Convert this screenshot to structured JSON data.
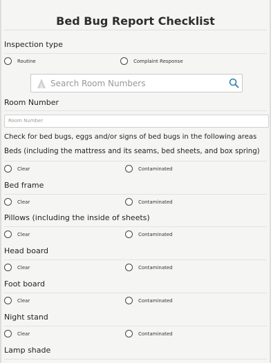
{
  "form": {
    "title": "Bed Bug Report Checklist",
    "inspection_type": {
      "label": "Inspection type",
      "options": [
        "Routine",
        "Complaint Response"
      ]
    },
    "search": {
      "placeholder": "Search Room Numbers"
    },
    "room_number": {
      "label": "Room Number",
      "placeholder": "Room Number"
    },
    "instructions": "Check for bed bugs, eggs and/or signs of bed bugs in the following areas",
    "areas": [
      {
        "label": "Beds (including the mattress and its seams, bed sheets, and box spring)"
      },
      {
        "label": "Bed frame"
      },
      {
        "label": "Pillows (including the inside of sheets)"
      },
      {
        "label": "Head board"
      },
      {
        "label": "Foot board"
      },
      {
        "label": "Night stand"
      },
      {
        "label": "Lamp shade"
      }
    ],
    "option_clear": "Clear",
    "option_contaminated": "Contaminated"
  },
  "colors": {
    "accent": "#2f7fb0",
    "title": "#2e2e2e"
  },
  "icons": {
    "search": "magnifier-icon",
    "logo": "app-logo-icon"
  }
}
